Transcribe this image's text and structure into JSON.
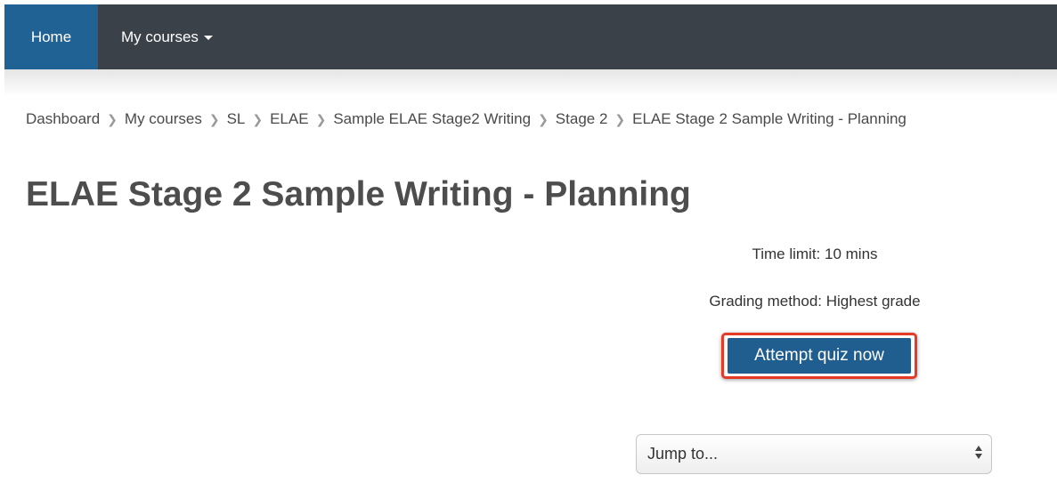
{
  "navbar": {
    "home_label": "Home",
    "my_courses_label": "My courses"
  },
  "breadcrumb": {
    "items": [
      "Dashboard",
      "My courses",
      "SL",
      "ELAE",
      "Sample ELAE Stage2 Writing",
      "Stage 2",
      "ELAE Stage 2 Sample Writing - Planning"
    ],
    "separator_icon": "chevron-right-icon"
  },
  "page": {
    "title": "ELAE Stage 2 Sample Writing - Planning"
  },
  "quiz_info": {
    "time_limit": "Time limit: 10 mins",
    "grading_method": "Grading method: Highest grade",
    "attempt_button_label": "Attempt quiz now"
  },
  "jump_menu": {
    "selected": "Jump to..."
  },
  "colors": {
    "navbar_bg": "#3b4148",
    "home_active_bg": "#216294",
    "primary_button": "#1f5e8e",
    "highlight_border": "#e53a26"
  }
}
